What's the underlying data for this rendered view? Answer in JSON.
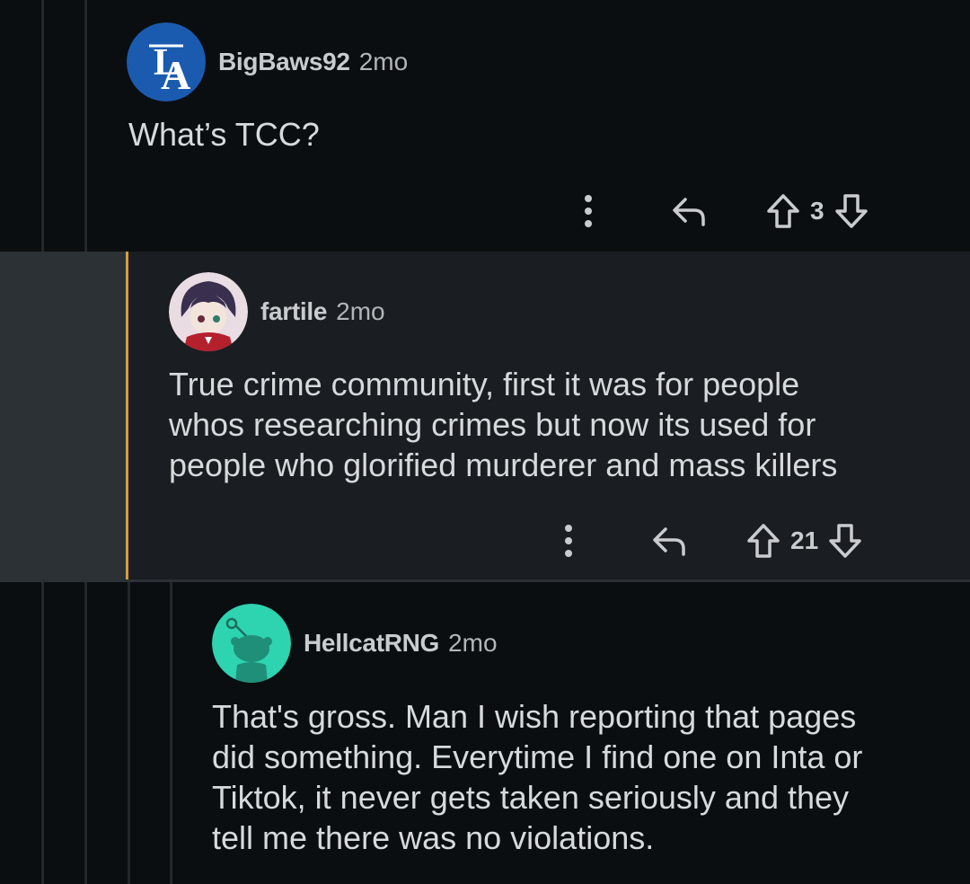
{
  "comments": [
    {
      "username": "BigBaws92",
      "time": "2mo",
      "text": "What’s TCC?",
      "score": "3",
      "avatar": "la-logo-avatar"
    },
    {
      "username": "fartile",
      "time": "2mo",
      "text_lines": [
        "True crime community, first it was for people",
        "whos researching crimes but now its used for",
        "people who glorified murderer and mass killers"
      ],
      "score": "21",
      "avatar": "anime-girl-avatar"
    },
    {
      "username": "HellcatRNG",
      "time": "2mo",
      "text_lines": [
        "That's gross. Man I wish reporting that pages",
        "did something. Everytime I find one on Inta or",
        "Tiktok, it never gets taken seriously and they",
        "tell me there was no violations."
      ],
      "avatar": "snoo-avatar"
    }
  ],
  "icons": [
    "more-vertical-icon",
    "reply-icon",
    "upvote-icon",
    "downvote-icon"
  ],
  "colors": {
    "background": "#0b0e11",
    "highlight_background": "#1a1d21",
    "accent": "#d79d3a",
    "snoo_avatar": "#2ed3b0",
    "la_avatar": "#1a5bb0"
  }
}
